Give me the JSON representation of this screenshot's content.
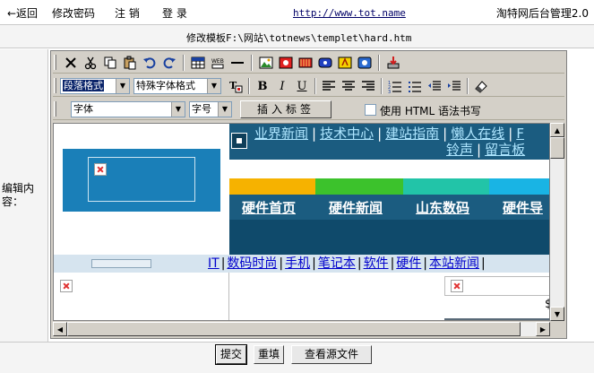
{
  "topbar": {
    "back": "←返回",
    "change_password": "修改密码",
    "logout": "注 销",
    "login": "登 录",
    "url": "http://www.tot.name",
    "brand": "淘特网后台管理2.0"
  },
  "path": "修改模板F:\\网站\\totnews\\templet\\hard.htm",
  "left_label": "编辑内容：",
  "toolbar": {
    "paragraph_format": "段落格式",
    "special_font": "特殊字体格式",
    "font": "字体",
    "font_size": "字号",
    "insert_tag": "插入标签",
    "html_syntax_label": "使用 HTML 语法书写"
  },
  "preview": {
    "top_links": [
      "业界新闻",
      "技术中心",
      "建站指南",
      "懒人在线",
      "F"
    ],
    "top_links2": [
      "铃声",
      "留言板"
    ],
    "tabs": [
      "硬件首页",
      "硬件新闻",
      "山东数码",
      "硬件导"
    ],
    "nav_links": [
      "IT",
      "数码时尚",
      "手机",
      "笔记本",
      "软件",
      "硬件",
      "本站新闻"
    ],
    "dollar": "$",
    "strip_colors": [
      "#f6b200",
      "#3cc22c",
      "#22c4a8",
      "#19b4e4"
    ]
  },
  "buttons": {
    "submit": "提交",
    "reset": "重填",
    "view_source": "查看源文件"
  },
  "colors": {
    "accent_blue": "#1b5c80",
    "link_blue": "#0000cc",
    "toolbar_gray": "#d4d0c8"
  }
}
